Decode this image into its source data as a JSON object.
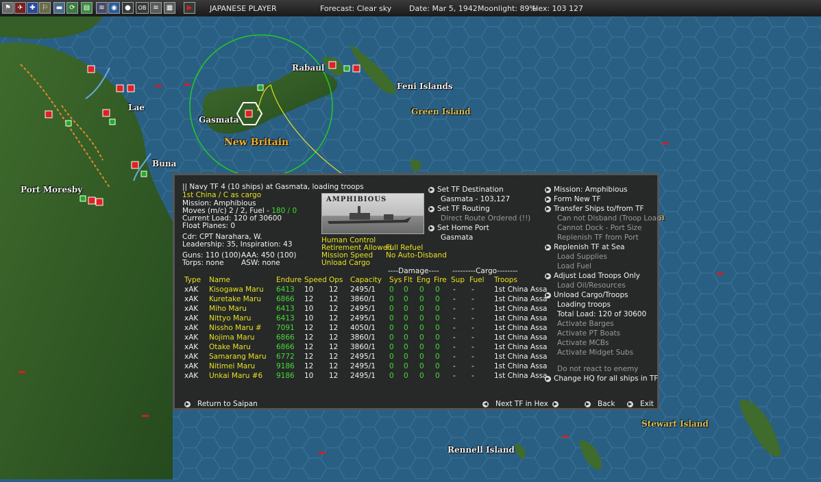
{
  "topbar": {
    "side": "JAPANESE PLAYER",
    "forecast": "Forecast: Clear sky",
    "date": "Date: Mar 5, 1942",
    "moonlight": "Moonlight: 89%",
    "hex": "Hex: 103 127",
    "icons": [
      "flag-icon",
      "plane-icon",
      "ship-icon",
      "base-icon",
      "carrier-icon",
      "cycle-icon",
      "report-icon",
      "airgroup-icon",
      "globe-icon",
      "disc-icon",
      "ob-icon",
      "list-icon",
      "grid-icon",
      "play-icon"
    ],
    "ob_label": "OB"
  },
  "map_labels": {
    "rabaul": "Rabaul",
    "feni": "Feni Islands",
    "green": "Green Island",
    "lae": "Lae",
    "gasmata": "Gasmata",
    "new_britain": "New Britain",
    "buna": "Buna",
    "port_moresby": "Port Moresby",
    "stewart": "Stewart Island",
    "rennell": "Rennell Island",
    "hidden_a": "a"
  },
  "tf": {
    "header": "|| Navy TF 4 (10 ships) at Gasmata, loading troops",
    "cargo": "1st China / C as cargo",
    "mission": "Mission: Amphibious",
    "moves": "Moves (m/c) 2 / 2, Fuel - ",
    "fuel": "180 / 0",
    "current_load": "Current Load: 120 of 30600",
    "float_planes": "Float Planes: 0",
    "cdr": "Cdr: CPT Narahara, W.",
    "leadership": "Leadership: 35, Inspiration: 43",
    "guns": "Guns: 110 (100)",
    "aaa": "AAA: 450 (100)",
    "torps": "Torps: none",
    "asw": "ASW: none",
    "photo_label": "AMPHIBIOUS",
    "human_control": "Human Control",
    "retirement": "Retirement Allowed",
    "full_refuel": "Full Refuel",
    "mission_speed": "Mission Speed",
    "no_auto_disband": "No Auto-Disband",
    "unload_cargo": "Unload Cargo"
  },
  "middle_actions": {
    "set_destination": "Set TF Destination",
    "destination_value": "Gasmata - 103,127",
    "set_routing": "Set TF Routing",
    "routing_value": "Direct Route Ordered (!!)",
    "set_home_port": "Set Home Port",
    "home_port_value": "Gasmata"
  },
  "right_actions": {
    "mission": "Mission: Amphibious",
    "form_new_tf": "Form New TF",
    "transfer": "Transfer Ships to/from TF",
    "cannot_disband": "Can not Disband (Troop Load)",
    "cannot_dock": "Cannot Dock - Port Size",
    "replenish_port": "Replenish TF from Port",
    "replenish_sea": "Replenish TF at Sea",
    "load_supplies": "Load Supplies",
    "load_fuel": "Load Fuel",
    "adjust_load": "Adjust Load Troops Only",
    "load_oil": "Load Oil/Resources",
    "unload_cargo": "Unload Cargo/Troops",
    "loading_troops": "Loading troops",
    "total_load": "Total Load: 120 of 30600",
    "barges": "Activate Barges",
    "pt_boats": "Activate PT Boats",
    "mcbs": "Activate MCBs",
    "midget": "Activate Midget Subs",
    "do_not_react": "Do not react to enemy",
    "change_hq": "Change HQ for all ships in TF"
  },
  "table": {
    "group_damage": "----Damage----",
    "group_cargo": "---------Cargo--------",
    "headers": {
      "type": "Type",
      "name": "Name",
      "endure": "Endure",
      "speed": "Speed",
      "ops": "Ops",
      "capacity": "Capacity",
      "sys": "Sys",
      "flt": "Flt",
      "eng": "Eng",
      "fire": "Fire",
      "sup": "Sup",
      "fuel": "Fuel",
      "troops": "Troops"
    },
    "rows": [
      {
        "type": "xAK",
        "name": "Kisogawa Maru",
        "endure": "6413",
        "speed": "10",
        "ops": "12",
        "capacity": "2495/1",
        "sys": "0",
        "flt": "0",
        "eng": "0",
        "fire": "0",
        "sup": "-",
        "fuel": "-",
        "troops": "1st China Assa"
      },
      {
        "type": "xAK",
        "name": "Kuretake Maru",
        "endure": "6866",
        "speed": "12",
        "ops": "12",
        "capacity": "3860/1",
        "sys": "0",
        "flt": "0",
        "eng": "0",
        "fire": "0",
        "sup": "-",
        "fuel": "-",
        "troops": "1st China Assa"
      },
      {
        "type": "xAK",
        "name": "Miho Maru",
        "endure": "6413",
        "speed": "10",
        "ops": "12",
        "capacity": "2495/1",
        "sys": "0",
        "flt": "0",
        "eng": "0",
        "fire": "0",
        "sup": "-",
        "fuel": "-",
        "troops": "1st China Assa"
      },
      {
        "type": "xAK",
        "name": "Nittyo Maru",
        "endure": "6413",
        "speed": "10",
        "ops": "12",
        "capacity": "2495/1",
        "sys": "0",
        "flt": "0",
        "eng": "0",
        "fire": "0",
        "sup": "-",
        "fuel": "-",
        "troops": "1st China Assa"
      },
      {
        "type": "xAK",
        "name": "Nissho Maru #",
        "endure": "7091",
        "speed": "12",
        "ops": "12",
        "capacity": "4050/1",
        "sys": "0",
        "flt": "0",
        "eng": "0",
        "fire": "0",
        "sup": "-",
        "fuel": "-",
        "troops": "1st China Assa"
      },
      {
        "type": "xAK",
        "name": "Nojima Maru",
        "endure": "6866",
        "speed": "12",
        "ops": "12",
        "capacity": "3860/1",
        "sys": "0",
        "flt": "0",
        "eng": "0",
        "fire": "0",
        "sup": "-",
        "fuel": "-",
        "troops": "1st China Assa"
      },
      {
        "type": "xAK",
        "name": "Otake Maru",
        "endure": "6866",
        "speed": "12",
        "ops": "12",
        "capacity": "3860/1",
        "sys": "0",
        "flt": "0",
        "eng": "0",
        "fire": "0",
        "sup": "-",
        "fuel": "-",
        "troops": "1st China Assa"
      },
      {
        "type": "xAK",
        "name": "Samarang Maru",
        "endure": "6772",
        "speed": "12",
        "ops": "12",
        "capacity": "2495/1",
        "sys": "0",
        "flt": "0",
        "eng": "0",
        "fire": "0",
        "sup": "-",
        "fuel": "-",
        "troops": "1st China Assa"
      },
      {
        "type": "xAK",
        "name": "Nitimei Maru",
        "endure": "9186",
        "speed": "12",
        "ops": "12",
        "capacity": "2495/1",
        "sys": "0",
        "flt": "0",
        "eng": "0",
        "fire": "0",
        "sup": "-",
        "fuel": "-",
        "troops": "1st China Assa"
      },
      {
        "type": "xAK",
        "name": "Unkai Maru #6",
        "endure": "9186",
        "speed": "10",
        "ops": "12",
        "capacity": "2495/1",
        "sys": "0",
        "flt": "0",
        "eng": "0",
        "fire": "0",
        "sup": "-",
        "fuel": "-",
        "troops": "1st China Assa"
      }
    ]
  },
  "footer": {
    "return": "Return to Saipan",
    "next_tf": "Next TF in Hex",
    "back": "Back",
    "exit": "Exit"
  },
  "colors": {
    "sea": "#2a5f84",
    "land": "#2f5a26",
    "highlight": "#e8e020",
    "value_green": "#44dd33"
  }
}
